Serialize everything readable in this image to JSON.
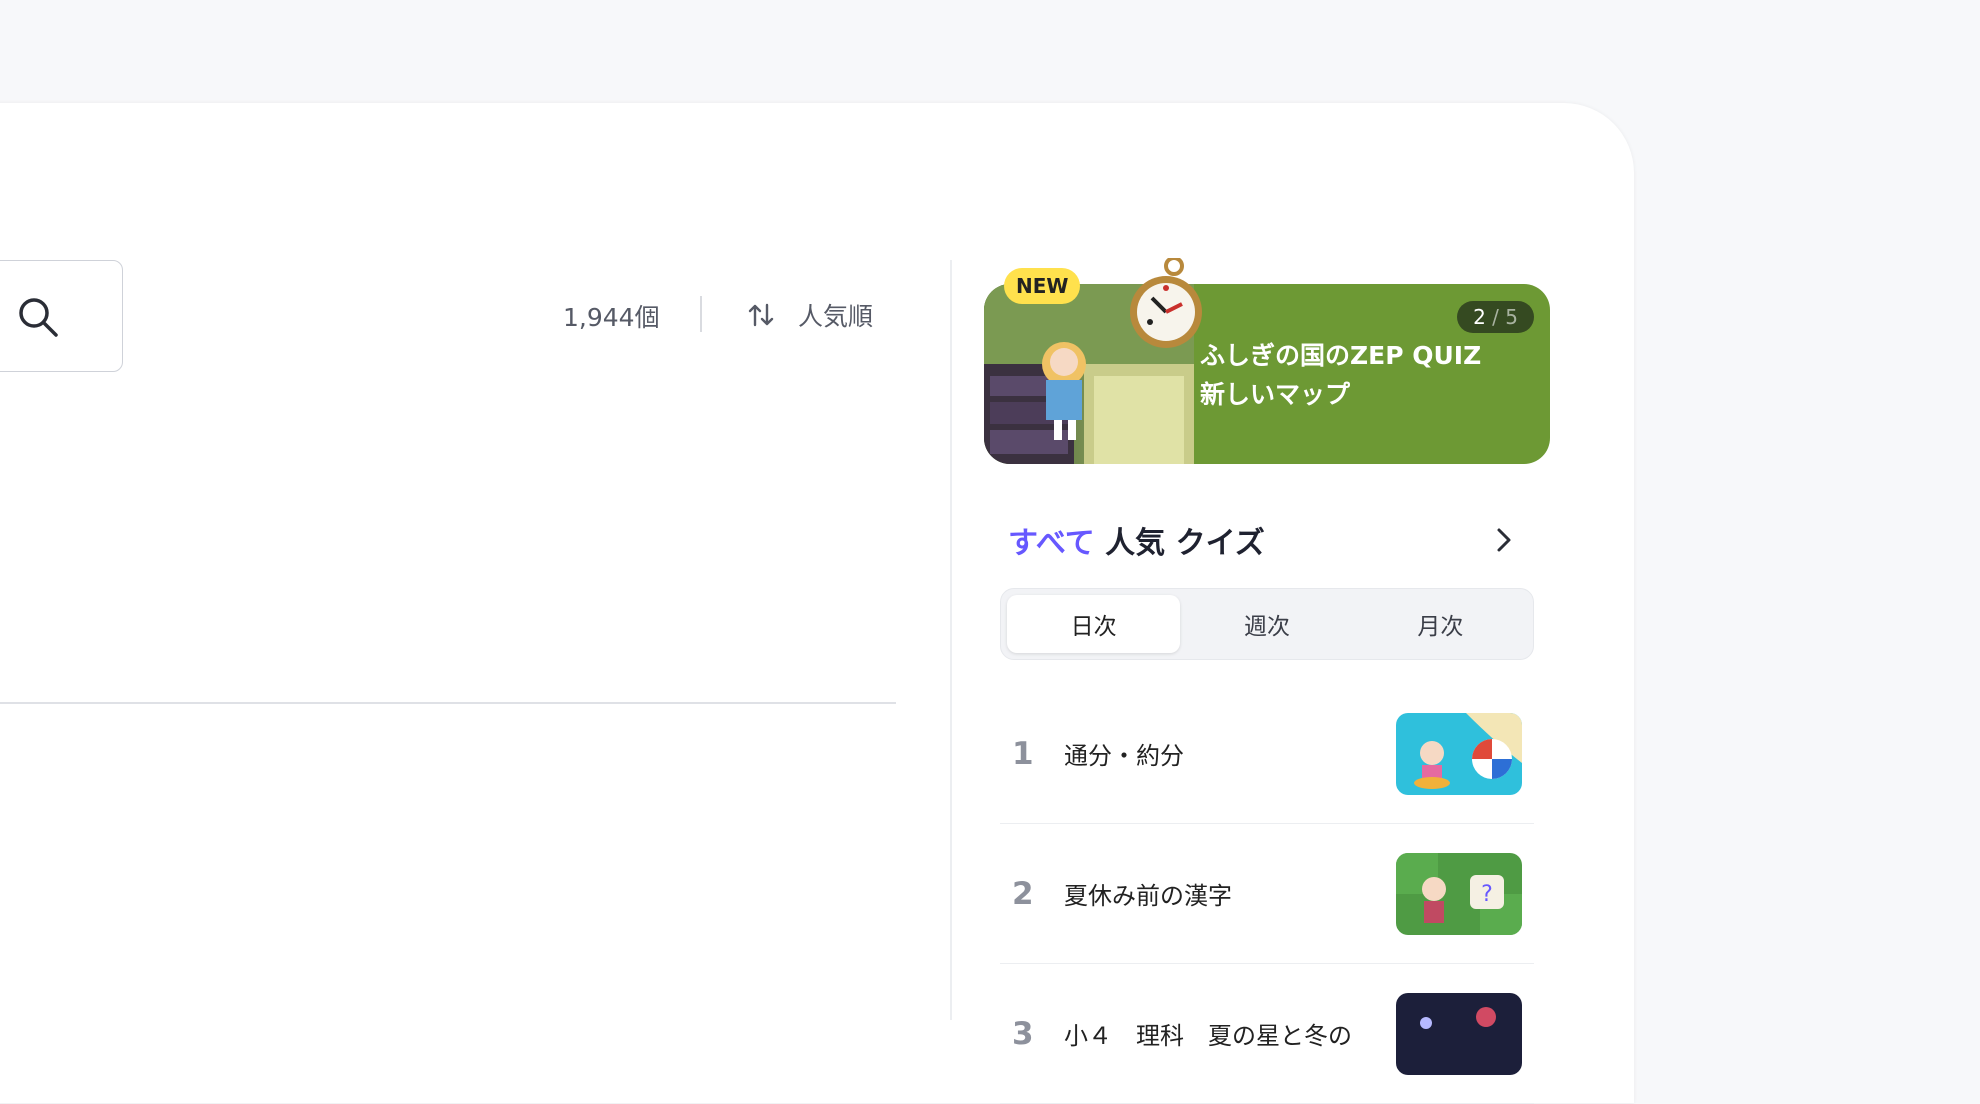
{
  "results": {
    "count_label": "1,944個",
    "sort_label": "人気順"
  },
  "banner": {
    "badge": "NEW",
    "page_current": "2",
    "page_sep": " / ",
    "page_total": "5",
    "title_line1": "ふしぎの国のZEP QUIZ",
    "title_line2": "新しいマップ"
  },
  "ranking": {
    "accent_text": "すべて",
    "heading_text": " 人気 クイズ",
    "tabs": [
      {
        "label": "日次",
        "active": true
      },
      {
        "label": "週次",
        "active": false
      },
      {
        "label": "月次",
        "active": false
      }
    ],
    "items": [
      {
        "rank": "1",
        "title": "通分・約分"
      },
      {
        "rank": "2",
        "title": "夏休み前の漢字"
      },
      {
        "rank": "3",
        "title": "小４　理科　夏の星と冬の"
      }
    ]
  },
  "colors": {
    "accent": "#6758ff",
    "banner_bg": "#6d9934",
    "badge": "#ffe14d"
  }
}
